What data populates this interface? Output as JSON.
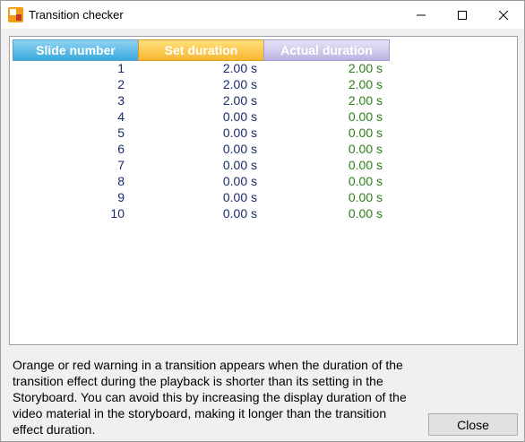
{
  "window": {
    "title": "Transition checker",
    "app_icon": "app-logo-icon"
  },
  "table": {
    "headers": {
      "slide": "Slide number",
      "set": "Set duration",
      "actual": "Actual duration"
    },
    "rows": [
      {
        "num": "1",
        "set": "2.00 s",
        "actual": "2.00 s"
      },
      {
        "num": "2",
        "set": "2.00 s",
        "actual": "2.00 s"
      },
      {
        "num": "3",
        "set": "2.00 s",
        "actual": "2.00 s"
      },
      {
        "num": "4",
        "set": "0.00 s",
        "actual": "0.00 s"
      },
      {
        "num": "5",
        "set": "0.00 s",
        "actual": "0.00 s"
      },
      {
        "num": "6",
        "set": "0.00 s",
        "actual": "0.00 s"
      },
      {
        "num": "7",
        "set": "0.00 s",
        "actual": "0.00 s"
      },
      {
        "num": "8",
        "set": "0.00 s",
        "actual": "0.00 s"
      },
      {
        "num": "9",
        "set": "0.00 s",
        "actual": "0.00 s"
      },
      {
        "num": "10",
        "set": "0.00 s",
        "actual": "0.00 s"
      }
    ]
  },
  "info": "Orange or red warning in a transition appears when the duration of the transition effect during the playback is shorter than its setting in the Storyboard. You can avoid this by increasing the display duration of the video material in the storyboard, making it longer than the transition effect duration.",
  "buttons": {
    "close": "Close"
  },
  "colors": {
    "set_value": "#1a2a6c",
    "actual_value": "#2e7d1a",
    "header_slide": "#3aa9de",
    "header_set": "#f8b731",
    "header_actual": "#bdb3e3"
  }
}
